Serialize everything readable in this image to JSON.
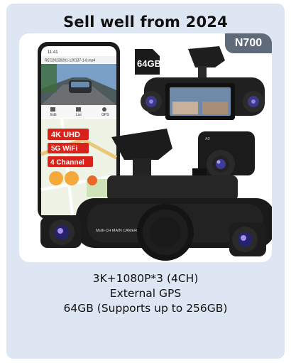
{
  "headline": "Sell well from 2024",
  "model_badge": "N700",
  "phone": {
    "file_name": "REC20230201-120137-1-8.mp4",
    "status_time": "11:41",
    "tabs": [
      "Edit",
      "List",
      "GPS"
    ]
  },
  "feature_tags": [
    "4K UHD",
    "5G WiFi",
    "4 Channel"
  ],
  "sd_card_label": "64GB",
  "camera_label": "Multi-CH MAIN CAMERA",
  "specs": [
    "3K+1080P*3 (4CH)",
    "External GPS",
    "64GB (Supports up to 256GB)"
  ],
  "colors": {
    "card_bg": "#dfe6f3",
    "badge_bg": "#5f6b7a",
    "tag_red": "#d8231a"
  }
}
